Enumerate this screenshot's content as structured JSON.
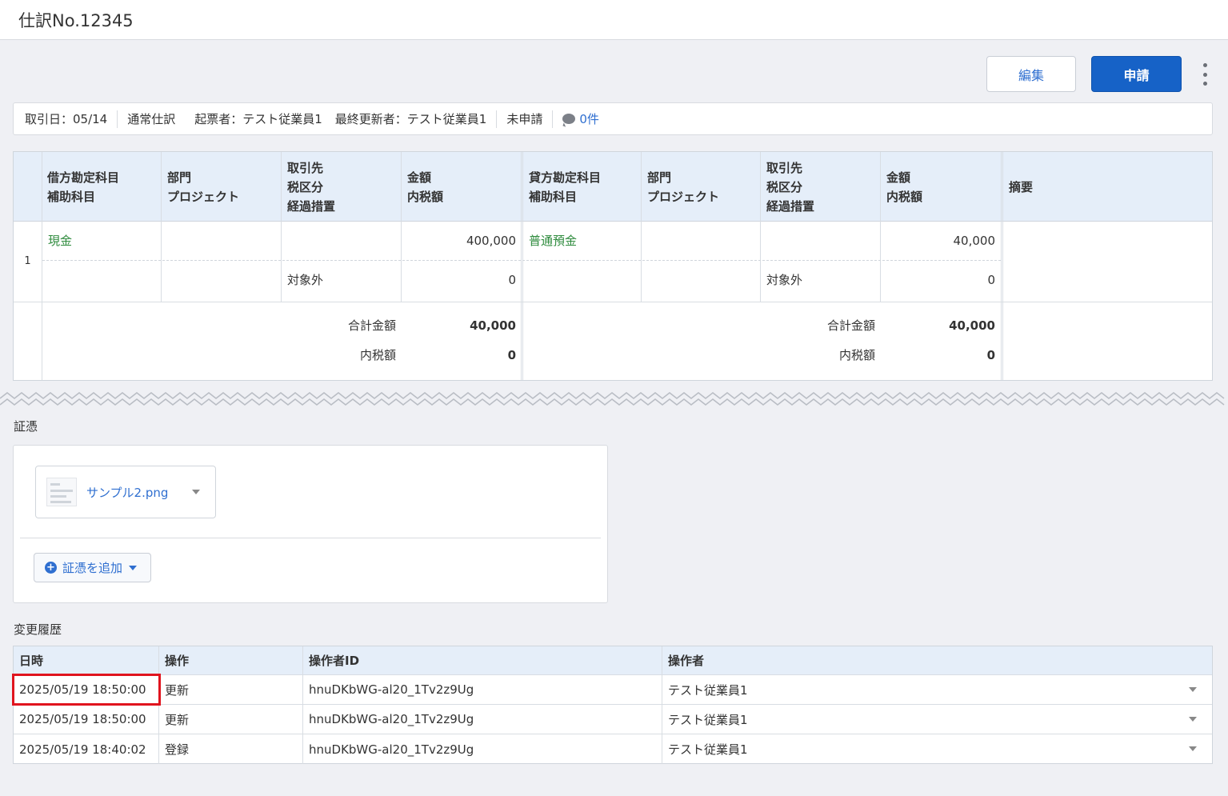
{
  "header": {
    "title": "仕訳No.12345"
  },
  "actions": {
    "edit_label": "編集",
    "apply_label": "申請"
  },
  "info": {
    "date": "取引日：05/14",
    "type": "通常仕訳",
    "creator": "起票者：テスト従業員1",
    "updater": "最終更新者：テスト従業員1",
    "status": "未申請",
    "comments": "0件"
  },
  "journal": {
    "headers": {
      "debit_account": [
        "借方勘定科目",
        "補助科目"
      ],
      "debit_dept": [
        "部門",
        "プロジェクト"
      ],
      "debit_partner": [
        "取引先",
        "税区分",
        "経過措置"
      ],
      "debit_amount": [
        "金額",
        "内税額"
      ],
      "credit_account": [
        "貸方勘定科目",
        "補助科目"
      ],
      "credit_dept": [
        "部門",
        "プロジェクト"
      ],
      "credit_partner": [
        "取引先",
        "税区分",
        "経過措置"
      ],
      "credit_amount": [
        "金額",
        "内税額"
      ],
      "memo": "摘要"
    },
    "rows": [
      {
        "no": "1",
        "debit_account": "現金",
        "debit_tax_class": "対象外",
        "debit_amount": "400,000",
        "debit_tax": "0",
        "credit_account": "普通預金",
        "credit_tax_class": "対象外",
        "credit_amount": "40,000",
        "credit_tax": "0"
      }
    ],
    "totals": {
      "total_label": "合計金額",
      "tax_label": "内税額",
      "debit_total": "40,000",
      "debit_tax": "0",
      "credit_total": "40,000",
      "credit_tax": "0"
    }
  },
  "voucher": {
    "section_title": "証憑",
    "file_name": "サンプル2.png",
    "add_label": "証憑を追加"
  },
  "history": {
    "section_title": "変更履歴",
    "columns": [
      "日時",
      "操作",
      "操作者ID",
      "操作者"
    ],
    "rows": [
      [
        "2025/05/19 18:50:00",
        "更新",
        "hnuDKbWG-al20_1Tv2z9Ug",
        "テスト従業員1"
      ],
      [
        "2025/05/19 18:50:00",
        "更新",
        "hnuDKbWG-al20_1Tv2z9Ug",
        "テスト従業員1"
      ],
      [
        "2025/05/19 18:40:02",
        "登録",
        "hnuDKbWG-al20_1Tv2z9Ug",
        "テスト従業員1"
      ]
    ]
  },
  "colors": {
    "accent": "#1662c7",
    "link": "#2f6fd0",
    "account": "#2e8b3d",
    "header_bg": "#e5eef9",
    "highlight": "#e0141e"
  }
}
